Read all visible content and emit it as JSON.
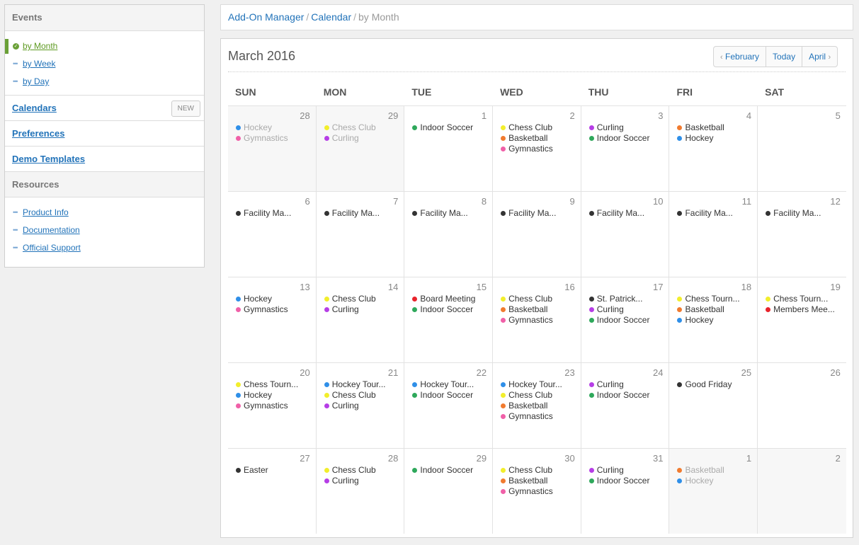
{
  "sidebar": {
    "events_header": "Events",
    "event_views": [
      {
        "label": "by Month",
        "active": true
      },
      {
        "label": "by Week",
        "active": false
      },
      {
        "label": "by Day",
        "active": false
      }
    ],
    "links": [
      {
        "label": "Calendars",
        "badge": "NEW"
      },
      {
        "label": "Preferences"
      },
      {
        "label": "Demo Templates"
      }
    ],
    "resources_header": "Resources",
    "resources": [
      "Product Info",
      "Documentation",
      "Official Support"
    ]
  },
  "breadcrumb": {
    "items": [
      "Add-On Manager",
      "Calendar"
    ],
    "current": "by Month",
    "separator": "/"
  },
  "calendar": {
    "title": "March 2016",
    "nav": {
      "prev": "February",
      "today": "Today",
      "next": "April"
    },
    "weekdays": [
      "SUN",
      "MON",
      "TUE",
      "WED",
      "THU",
      "FRI",
      "SAT"
    ],
    "colors": {
      "yellow": "#f2ee2c",
      "purple": "#b63ee6",
      "green": "#2ea85b",
      "orange": "#f17b2f",
      "pink": "#f060a8",
      "blue": "#2f8fe8",
      "black": "#333333",
      "red": "#e8232b"
    },
    "weeks": [
      [
        {
          "n": "28",
          "other": true,
          "ev": [
            [
              "blue",
              "Hockey"
            ],
            [
              "pink",
              "Gymnastics"
            ]
          ]
        },
        {
          "n": "29",
          "other": true,
          "ev": [
            [
              "yellow",
              "Chess Club"
            ],
            [
              "purple",
              "Curling"
            ]
          ]
        },
        {
          "n": "1",
          "ev": [
            [
              "green",
              "Indoor Soccer"
            ]
          ]
        },
        {
          "n": "2",
          "ev": [
            [
              "yellow",
              "Chess Club"
            ],
            [
              "orange",
              "Basketball"
            ],
            [
              "pink",
              "Gymnastics"
            ]
          ]
        },
        {
          "n": "3",
          "ev": [
            [
              "purple",
              "Curling"
            ],
            [
              "green",
              "Indoor Soccer"
            ]
          ]
        },
        {
          "n": "4",
          "ev": [
            [
              "orange",
              "Basketball"
            ],
            [
              "blue",
              "Hockey"
            ]
          ]
        },
        {
          "n": "5",
          "ev": []
        }
      ],
      [
        {
          "n": "6",
          "ev": [
            [
              "black",
              "Facility Ma..."
            ]
          ]
        },
        {
          "n": "7",
          "ev": [
            [
              "black",
              "Facility Ma..."
            ]
          ]
        },
        {
          "n": "8",
          "ev": [
            [
              "black",
              "Facility Ma..."
            ]
          ]
        },
        {
          "n": "9",
          "ev": [
            [
              "black",
              "Facility Ma..."
            ]
          ]
        },
        {
          "n": "10",
          "ev": [
            [
              "black",
              "Facility Ma..."
            ]
          ]
        },
        {
          "n": "11",
          "ev": [
            [
              "black",
              "Facility Ma..."
            ]
          ]
        },
        {
          "n": "12",
          "ev": [
            [
              "black",
              "Facility Ma..."
            ]
          ]
        }
      ],
      [
        {
          "n": "13",
          "ev": [
            [
              "blue",
              "Hockey"
            ],
            [
              "pink",
              "Gymnastics"
            ]
          ]
        },
        {
          "n": "14",
          "ev": [
            [
              "yellow",
              "Chess Club"
            ],
            [
              "purple",
              "Curling"
            ]
          ]
        },
        {
          "n": "15",
          "ev": [
            [
              "red",
              "Board Meeting"
            ],
            [
              "green",
              "Indoor Soccer"
            ]
          ]
        },
        {
          "n": "16",
          "ev": [
            [
              "yellow",
              "Chess Club"
            ],
            [
              "orange",
              "Basketball"
            ],
            [
              "pink",
              "Gymnastics"
            ]
          ]
        },
        {
          "n": "17",
          "ev": [
            [
              "black",
              "St. Patrick..."
            ],
            [
              "purple",
              "Curling"
            ],
            [
              "green",
              "Indoor Soccer"
            ]
          ]
        },
        {
          "n": "18",
          "ev": [
            [
              "yellow",
              "Chess Tourn..."
            ],
            [
              "orange",
              "Basketball"
            ],
            [
              "blue",
              "Hockey"
            ]
          ]
        },
        {
          "n": "19",
          "ev": [
            [
              "yellow",
              "Chess Tourn..."
            ],
            [
              "red",
              "Members Mee..."
            ]
          ]
        }
      ],
      [
        {
          "n": "20",
          "ev": [
            [
              "yellow",
              "Chess Tourn..."
            ],
            [
              "blue",
              "Hockey"
            ],
            [
              "pink",
              "Gymnastics"
            ]
          ]
        },
        {
          "n": "21",
          "ev": [
            [
              "blue",
              "Hockey Tour..."
            ],
            [
              "yellow",
              "Chess Club"
            ],
            [
              "purple",
              "Curling"
            ]
          ]
        },
        {
          "n": "22",
          "ev": [
            [
              "blue",
              "Hockey Tour..."
            ],
            [
              "green",
              "Indoor Soccer"
            ]
          ]
        },
        {
          "n": "23",
          "ev": [
            [
              "blue",
              "Hockey Tour..."
            ],
            [
              "yellow",
              "Chess Club"
            ],
            [
              "orange",
              "Basketball"
            ],
            [
              "pink",
              "Gymnastics"
            ]
          ]
        },
        {
          "n": "24",
          "ev": [
            [
              "purple",
              "Curling"
            ],
            [
              "green",
              "Indoor Soccer"
            ]
          ]
        },
        {
          "n": "25",
          "ev": [
            [
              "black",
              "Good Friday"
            ]
          ]
        },
        {
          "n": "26",
          "ev": []
        }
      ],
      [
        {
          "n": "27",
          "ev": [
            [
              "black",
              "Easter"
            ]
          ]
        },
        {
          "n": "28",
          "ev": [
            [
              "yellow",
              "Chess Club"
            ],
            [
              "purple",
              "Curling"
            ]
          ]
        },
        {
          "n": "29",
          "ev": [
            [
              "green",
              "Indoor Soccer"
            ]
          ]
        },
        {
          "n": "30",
          "ev": [
            [
              "yellow",
              "Chess Club"
            ],
            [
              "orange",
              "Basketball"
            ],
            [
              "pink",
              "Gymnastics"
            ]
          ]
        },
        {
          "n": "31",
          "ev": [
            [
              "purple",
              "Curling"
            ],
            [
              "green",
              "Indoor Soccer"
            ]
          ]
        },
        {
          "n": "1",
          "other": true,
          "ev": [
            [
              "orange",
              "Basketball"
            ],
            [
              "blue",
              "Hockey"
            ]
          ]
        },
        {
          "n": "2",
          "other": true,
          "ev": []
        }
      ]
    ]
  }
}
